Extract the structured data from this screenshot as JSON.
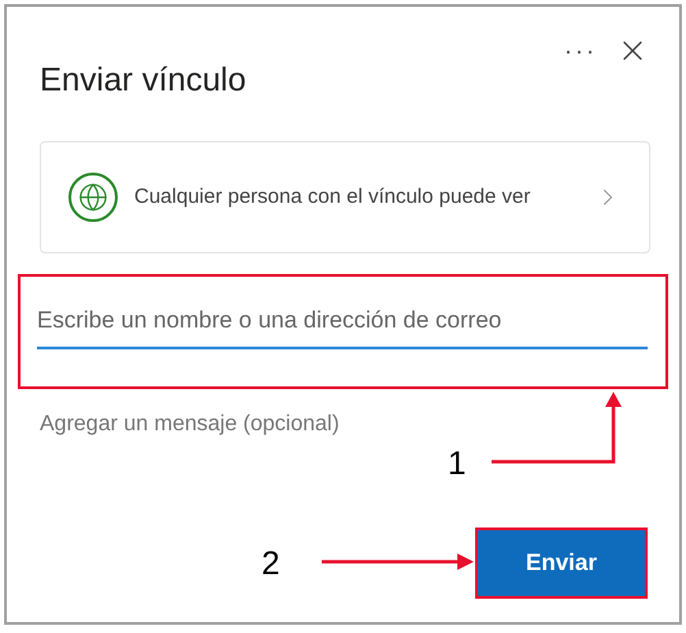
{
  "dialog": {
    "title": "Enviar vínculo",
    "more_label": "···"
  },
  "permission": {
    "text": "Cualquier persona con el vínculo puede ver"
  },
  "recipient_field": {
    "placeholder": "Escribe un nombre o una dirección de correo",
    "focused": true
  },
  "message_field": {
    "placeholder": "Agregar un mensaje (opcional)"
  },
  "send_button": {
    "label": "Enviar"
  },
  "annotations": {
    "field_callout": {
      "label": "1"
    },
    "button_callout": {
      "label": "2"
    }
  }
}
